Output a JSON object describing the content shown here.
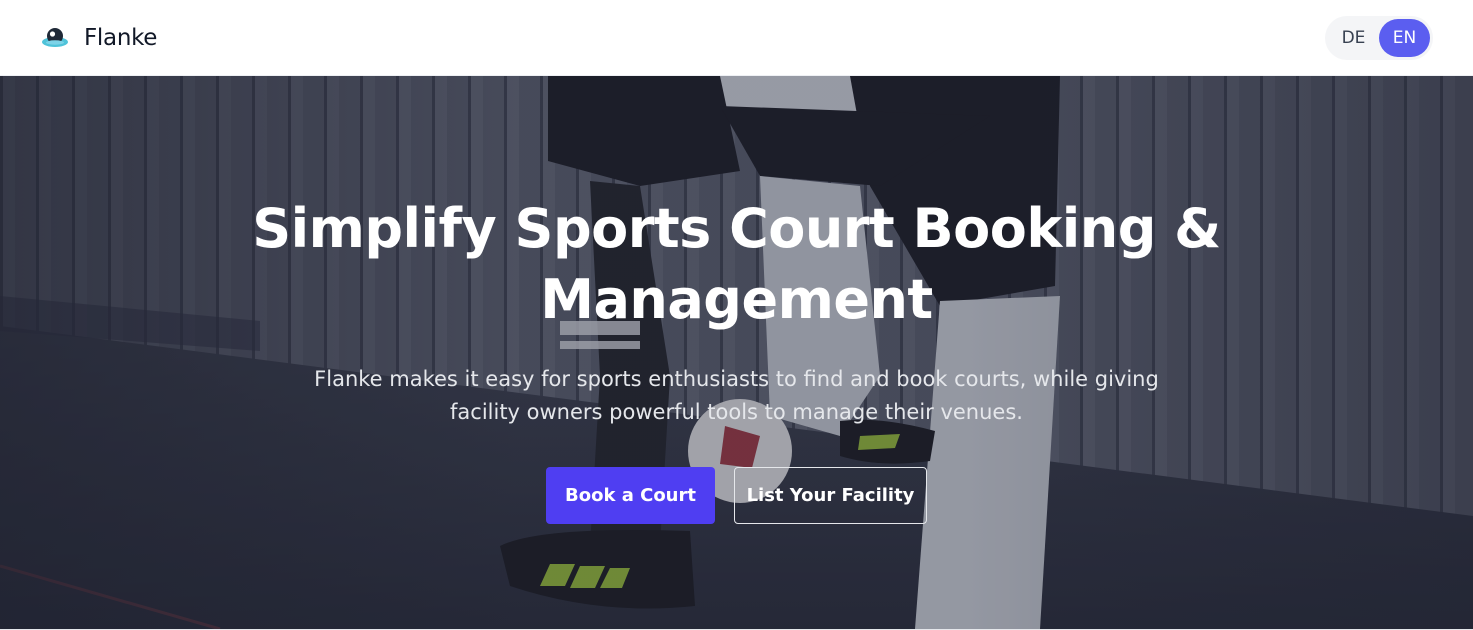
{
  "navbar": {
    "brand_name": "Flanke",
    "logo_icon": "ufo-icon",
    "languages": [
      {
        "code": "DE",
        "active": false
      },
      {
        "code": "EN",
        "active": true
      }
    ]
  },
  "hero": {
    "title": "Simplify Sports Court Booking & Management",
    "subtitle": "Flanke makes it easy for sports enthusiasts to find and book courts, while giving facility owners powerful tools to manage their venues.",
    "primary_cta": "Book a Court",
    "secondary_cta": "List Your Facility",
    "background": "photo of futsal players' legs and ball on indoor court"
  },
  "colors": {
    "accent": "#5b5ef0",
    "primary_button": "#4f3ef2",
    "text_dark": "#111827"
  }
}
